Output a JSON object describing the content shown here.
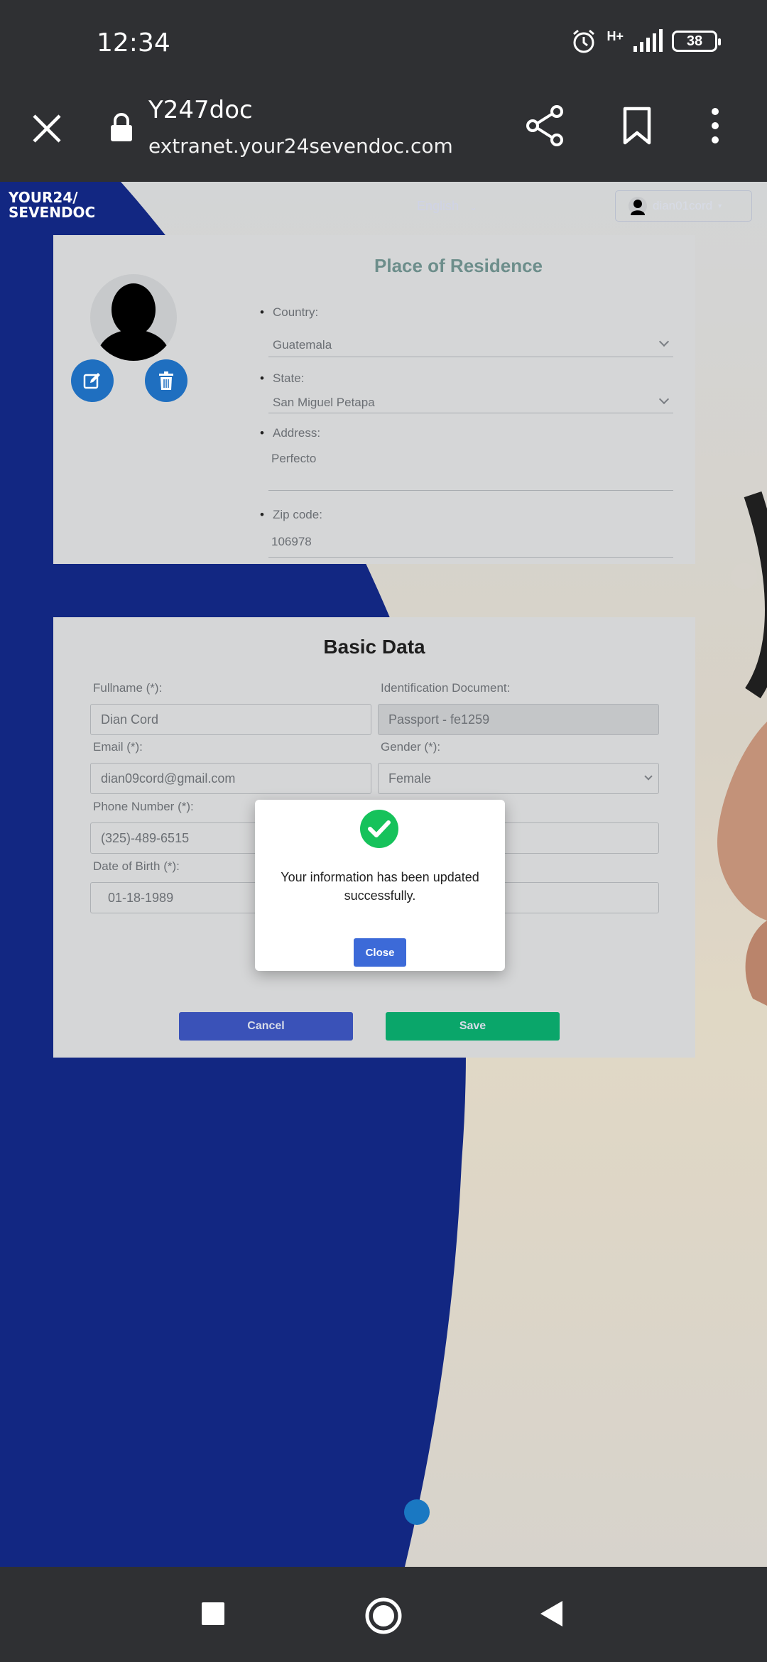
{
  "status_bar": {
    "time": "12:34",
    "network": "H+",
    "battery": "38"
  },
  "browser": {
    "title": "Y247doc",
    "url": "extranet.your24sevendoc.com"
  },
  "site": {
    "logo_line1": "YOUR24/",
    "logo_line2": "SEVENDOC",
    "language": "English",
    "username": "dian01cord"
  },
  "residence": {
    "title": "Place of Residence",
    "country_label": "Country:",
    "country_value": "Guatemala",
    "state_label": "State:",
    "state_value": "San Miguel Petapa",
    "address_label": "Address:",
    "address_value": "Perfecto",
    "zip_label": "Zip code:",
    "zip_value": "106978"
  },
  "basic": {
    "title": "Basic Data",
    "fullname_label": "Fullname (*):",
    "fullname_value": "Dian Cord",
    "id_label": "Identification Document:",
    "id_value": "Passport - fe1259",
    "email_label": "Email (*):",
    "email_value": "dian09cord@gmail.com",
    "gender_label": "Gender (*):",
    "gender_value": "Female",
    "phone_label": "Phone Number (*):",
    "phone_value": "(325)-489-6515",
    "dob_label": "Date of Birth (*):",
    "dob_value": "01-18-1989",
    "cancel_label": "Cancel",
    "save_label": "Save"
  },
  "modal": {
    "message": "Your information has been updated successfully.",
    "close_label": "Close"
  },
  "colors": {
    "brand_blue": "#142a8c",
    "save_green": "#0aa66a",
    "cancel_blue": "#3a52b8",
    "success_green": "#16c25b"
  }
}
